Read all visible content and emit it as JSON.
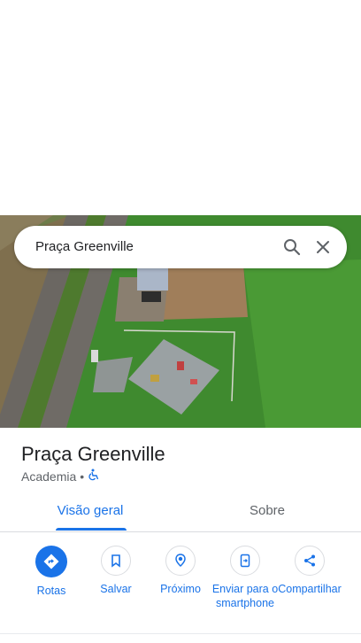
{
  "search": {
    "query": "Praça Greenville"
  },
  "place": {
    "name": "Praça Greenville",
    "category": "Academia",
    "separator": "•"
  },
  "tabs": [
    {
      "label": "Visão geral",
      "selected": true
    },
    {
      "label": "Sobre",
      "selected": false
    }
  ],
  "actions": [
    {
      "label": "Rotas",
      "icon": "directions-icon"
    },
    {
      "label": "Salvar",
      "icon": "bookmark-icon"
    },
    {
      "label": "Próximo",
      "icon": "nearby-icon"
    },
    {
      "label": "Enviar para o smartphone",
      "icon": "send-to-phone-icon"
    },
    {
      "label": "Compartilhar",
      "icon": "share-icon"
    }
  ],
  "colors": {
    "accent": "#1a73e8",
    "secondary_text": "#5f6368"
  }
}
